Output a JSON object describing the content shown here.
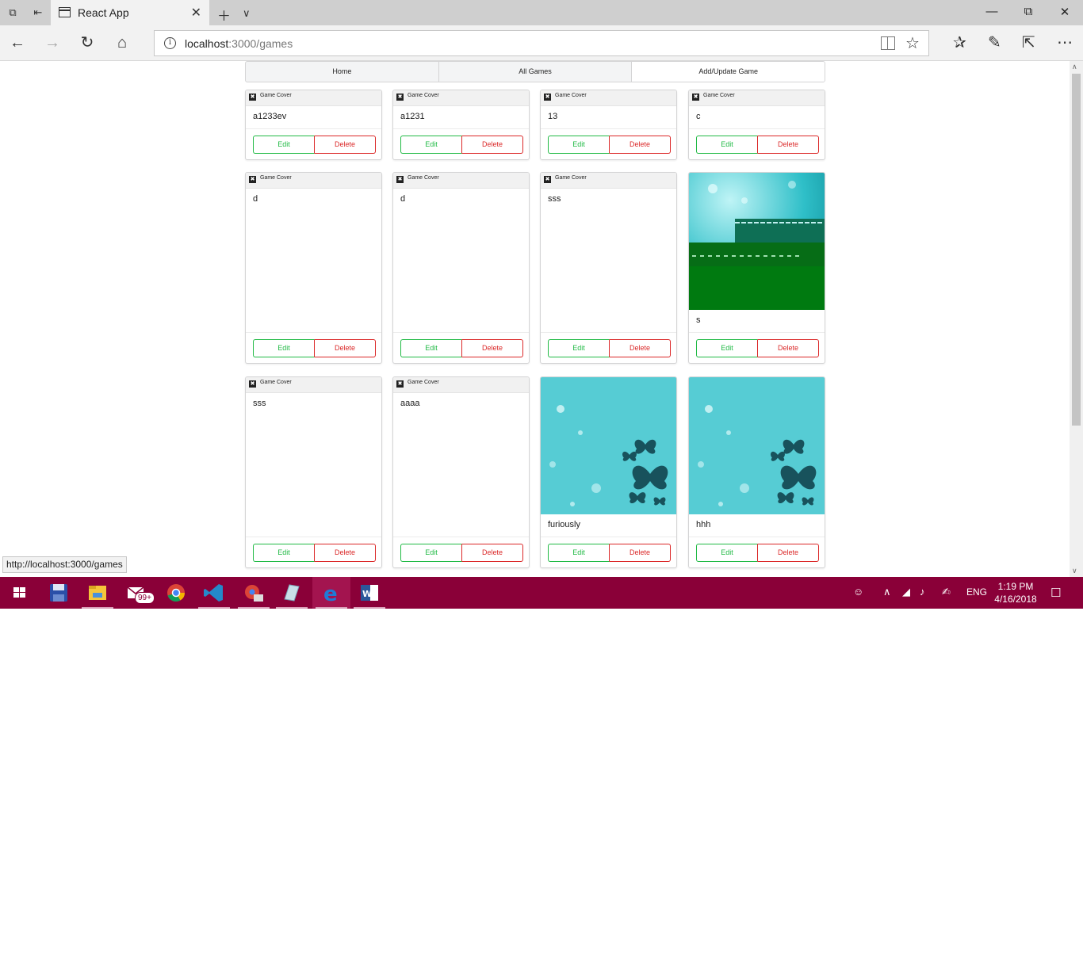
{
  "browser": {
    "tab_title": "React App",
    "address_host": "localhost",
    "address_path": ":3000/games",
    "status_url": "http://localhost:3000/games"
  },
  "nav_menu": {
    "items": [
      "Home",
      "All Games",
      "Add/Update Game"
    ],
    "active_index": 2
  },
  "cards": [
    {
      "name": "a1233ev",
      "image": "broken",
      "alt": "Game Cover",
      "edit": "Edit",
      "delete": "Delete"
    },
    {
      "name": "a1231",
      "image": "broken",
      "alt": "Game Cover",
      "edit": "Edit",
      "delete": "Delete"
    },
    {
      "name": "13",
      "image": "broken",
      "alt": "Game Cover",
      "edit": "Edit",
      "delete": "Delete"
    },
    {
      "name": "c",
      "image": "broken",
      "alt": "Game Cover",
      "edit": "Edit",
      "delete": "Delete"
    },
    {
      "name": "d",
      "image": "broken",
      "alt": "Game Cover",
      "edit": "Edit",
      "delete": "Delete"
    },
    {
      "name": "d",
      "image": "broken",
      "alt": "Game Cover",
      "edit": "Edit",
      "delete": "Delete"
    },
    {
      "name": "sss",
      "image": "broken",
      "alt": "Game Cover",
      "edit": "Edit",
      "delete": "Delete"
    },
    {
      "name": "s",
      "image": "teal-green-cover",
      "alt": "",
      "edit": "Edit",
      "delete": "Delete"
    },
    {
      "name": "sss",
      "image": "broken",
      "alt": "Game Cover",
      "edit": "Edit",
      "delete": "Delete"
    },
    {
      "name": "aaaa",
      "image": "broken",
      "alt": "Game Cover",
      "edit": "Edit",
      "delete": "Delete"
    },
    {
      "name": "furiously",
      "image": "teal-butterfly-cover",
      "alt": "",
      "edit": "Edit",
      "delete": "Delete"
    },
    {
      "name": "hhh",
      "image": "teal-butterfly-cover",
      "alt": "",
      "edit": "Edit",
      "delete": "Delete"
    }
  ],
  "taskbar": {
    "mail_badge": "99+",
    "language": "ENG",
    "time": "1:19 PM",
    "date": "4/16/2018"
  },
  "colors": {
    "edit": "#21ba45",
    "delete": "#db2828",
    "taskbar": "#8a0038",
    "cover_teal": "#2fbfc8",
    "cover_green": "#007a10"
  }
}
